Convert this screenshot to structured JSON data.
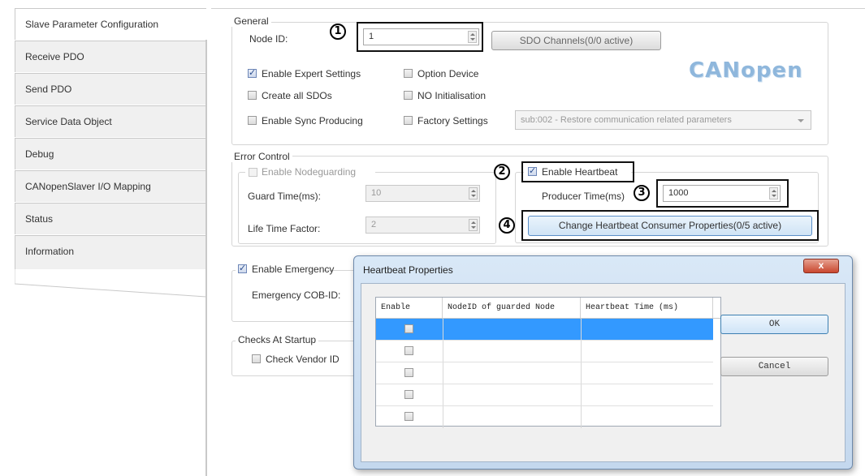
{
  "tabs": [
    {
      "label": "Slave Parameter Configuration",
      "active": true
    },
    {
      "label": "Receive PDO"
    },
    {
      "label": "Send PDO"
    },
    {
      "label": "Service Data Object"
    },
    {
      "label": "Debug"
    },
    {
      "label": "CANopenSlaver I/O Mapping"
    },
    {
      "label": "Status"
    },
    {
      "label": "Information"
    }
  ],
  "general": {
    "title": "General",
    "node_id_label": "Node ID:",
    "node_id_value": "1",
    "sdo_channels_button": "SDO Channels(0/0 active)",
    "logo_text": "CANopen",
    "enable_expert": {
      "label": "Enable Expert Settings",
      "checked": true
    },
    "option_device": {
      "label": "Option Device",
      "checked": false
    },
    "create_sdos": {
      "label": "Create all SDOs",
      "checked": false
    },
    "no_init": {
      "label": "NO Initialisation",
      "checked": false
    },
    "sync_producing": {
      "label": "Enable Sync Producing",
      "checked": false
    },
    "factory_settings": {
      "label": "Factory Settings",
      "checked": false
    },
    "factory_select_value": "sub:002 - Restore communication related parameters"
  },
  "error_control": {
    "title": "Error Control",
    "nodeguarding": {
      "label": "Enable Nodeguarding",
      "checked": false
    },
    "guard_time_label": "Guard Time(ms):",
    "guard_time_value": "10",
    "life_time_label": "Life Time Factor:",
    "life_time_value": "2",
    "heartbeat": {
      "label": "Enable Heartbeat",
      "checked": true
    },
    "producer_time_label": "Producer Time(ms)",
    "producer_time_value": "1000",
    "consumer_button": "Change Heartbeat Consumer Properties(0/5 active)"
  },
  "emergency": {
    "checkbox": {
      "label": "Enable Emergency",
      "checked": true
    },
    "cob_id_label": "Emergency COB-ID:"
  },
  "checks": {
    "title": "Checks At Startup",
    "vendor_id": {
      "label": "Check Vendor ID",
      "checked": false
    }
  },
  "markers": [
    "1",
    "2",
    "3",
    "4"
  ],
  "dialog": {
    "title": "Heartbeat Properties",
    "close_glyph": "x",
    "columns": [
      "Enable",
      "NodeID of guarded Node",
      "Heartbeat Time (ms)"
    ],
    "rows": [
      {
        "enabled": false,
        "node_id": "",
        "time": "",
        "selected": true
      },
      {
        "enabled": false,
        "node_id": "",
        "time": ""
      },
      {
        "enabled": false,
        "node_id": "",
        "time": ""
      },
      {
        "enabled": false,
        "node_id": "",
        "time": ""
      },
      {
        "enabled": false,
        "node_id": "",
        "time": ""
      }
    ],
    "ok_label": "OK",
    "cancel_label": "Cancel"
  }
}
